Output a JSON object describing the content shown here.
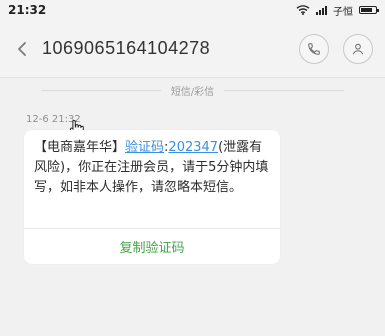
{
  "status_bar": {
    "time": "21:32",
    "network_text": "子恒",
    "wifi_icon": "wifi-icon",
    "signal_icon": "signal-icon",
    "battery_icon": "battery-icon"
  },
  "header": {
    "back_icon": "back-arrow-icon",
    "phone_number": "1069065164104278",
    "call_icon": "phone-icon",
    "contact_icon": "contact-icon"
  },
  "thread": {
    "section_label": "短信/彩信",
    "timestamp": "12-6 21:32"
  },
  "message": {
    "prefix": "【电商嘉年华】",
    "link_label": "验证码",
    "separator": ":",
    "code": "202347",
    "suffix": "(泄露有风险)，你正在注册会员，请于5分钟内填写，如非本人操作，请忽略本短信。",
    "copy_button": "复制验证码",
    "link_color": "#3a8fe0",
    "action_color": "#44a34a"
  }
}
